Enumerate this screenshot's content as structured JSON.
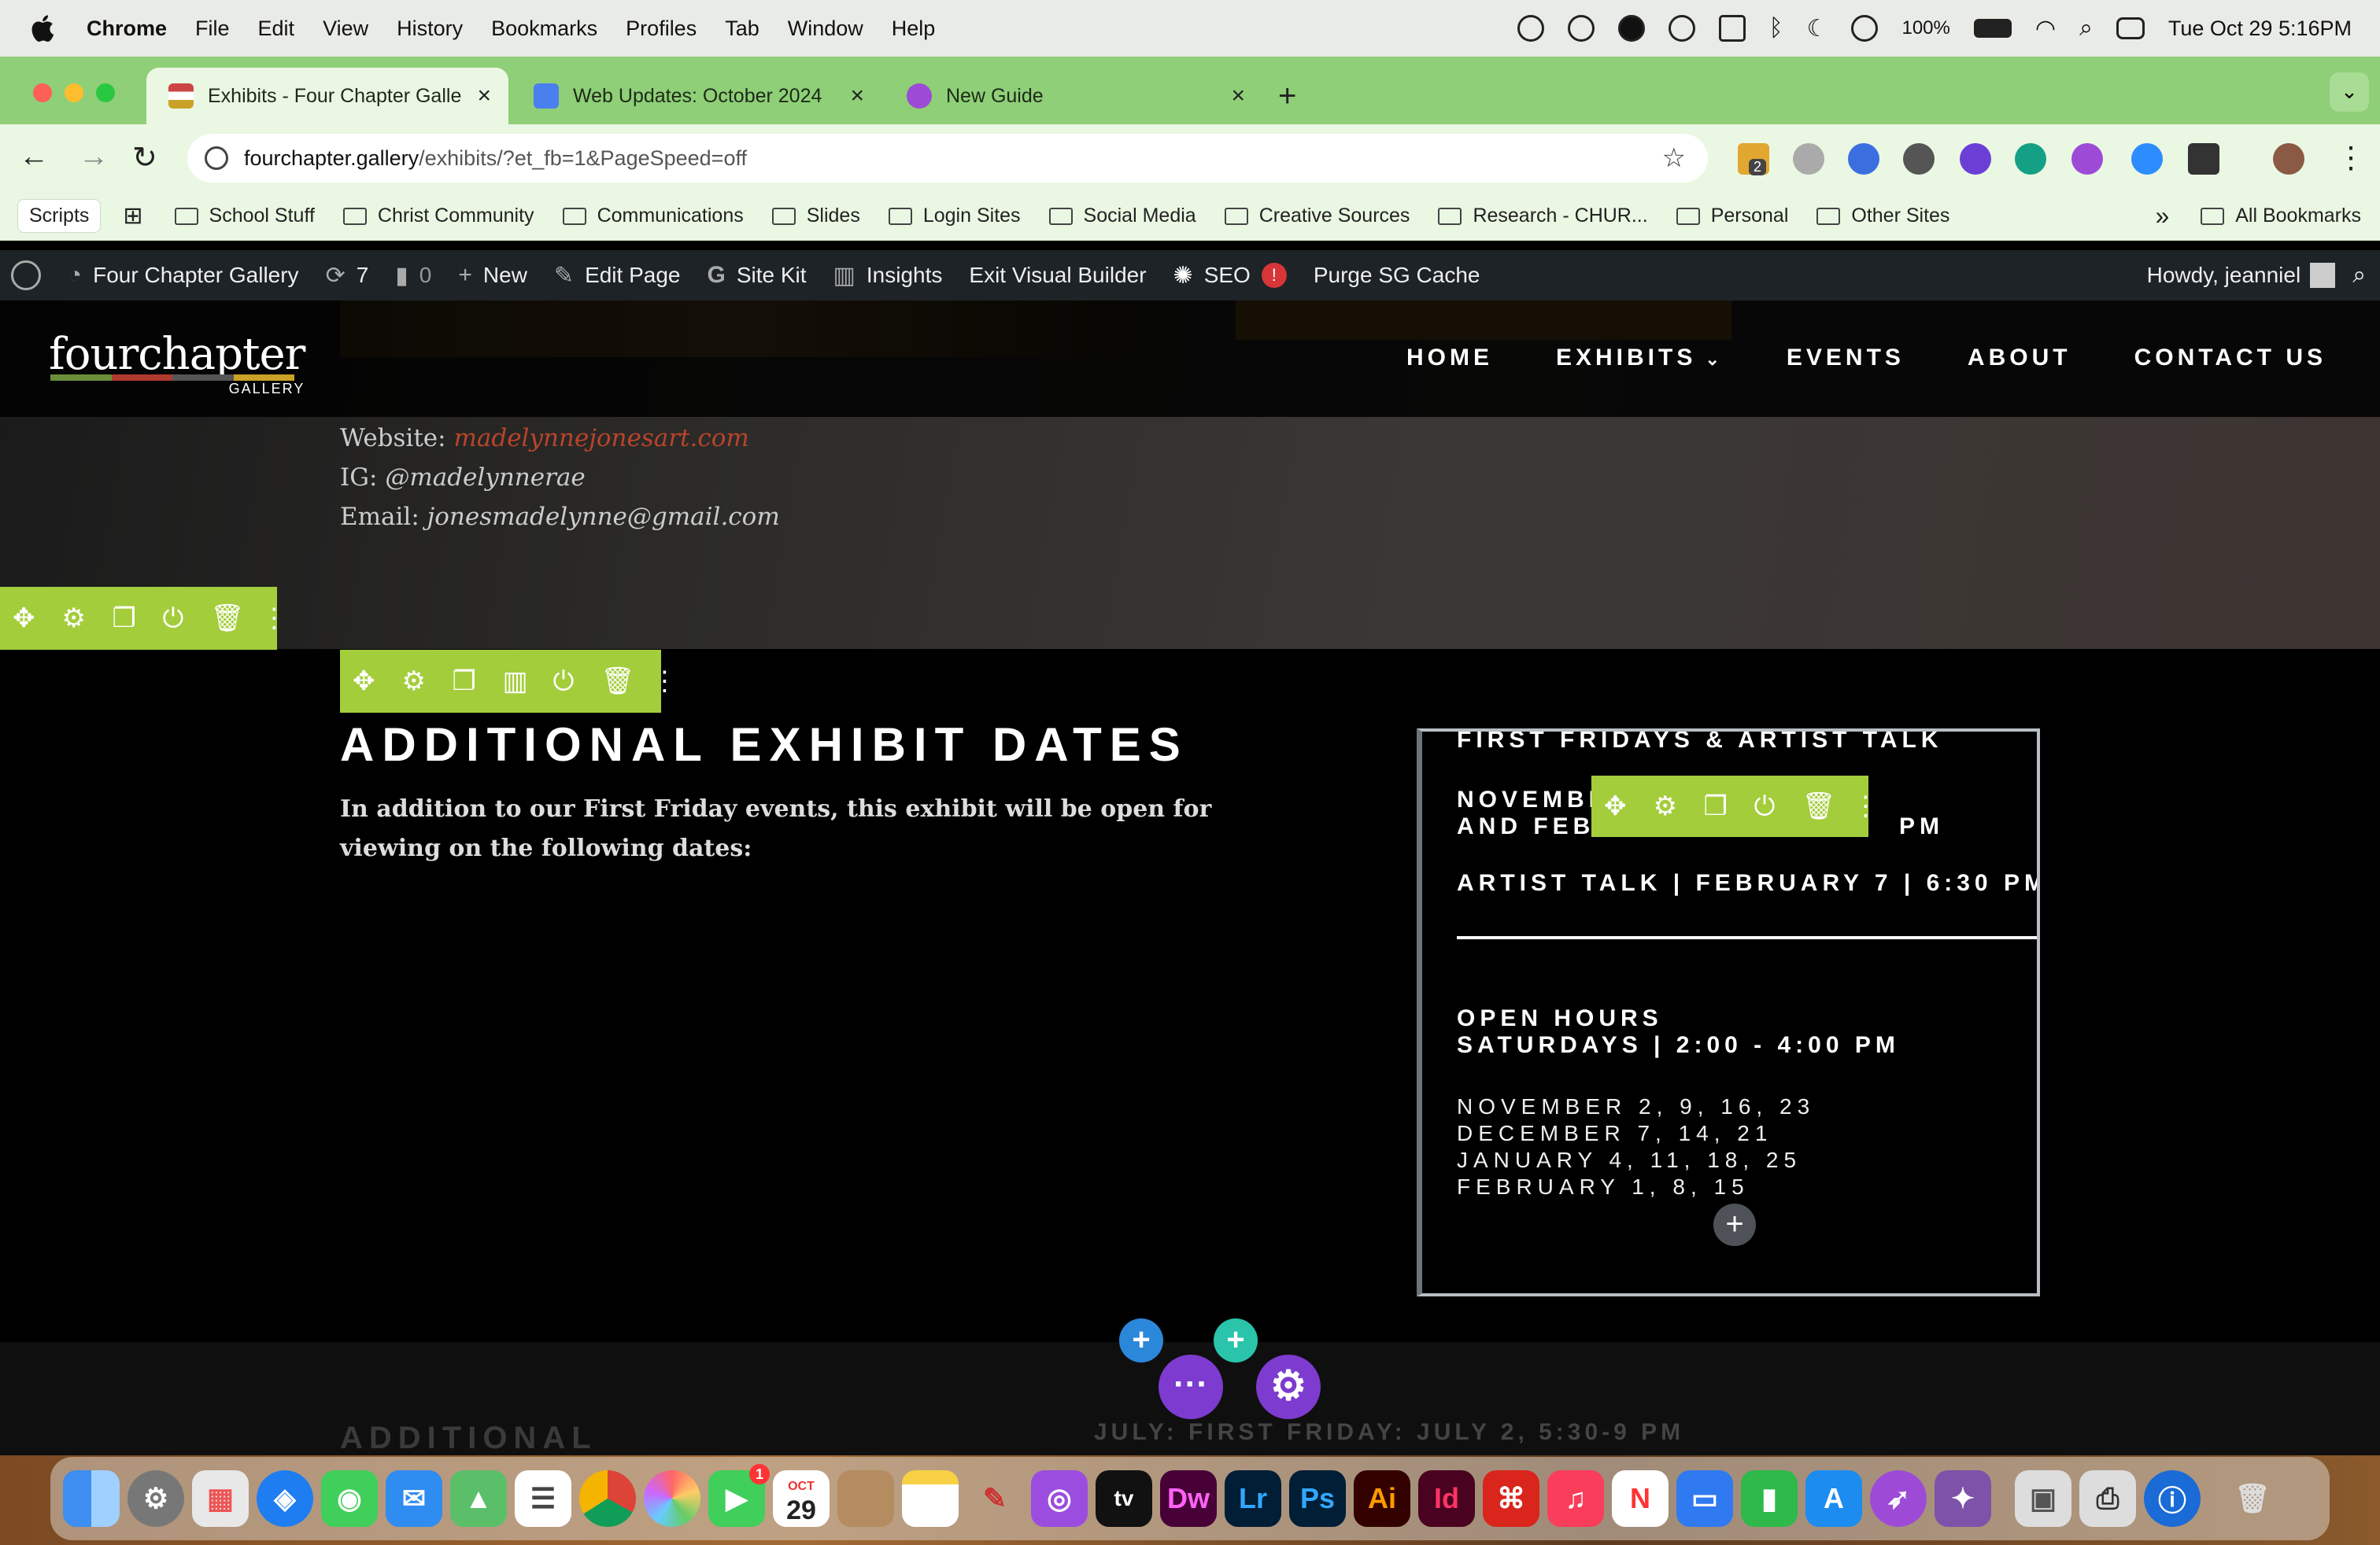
{
  "menubar": {
    "app": "Chrome",
    "items": [
      "File",
      "Edit",
      "View",
      "History",
      "Bookmarks",
      "Profiles",
      "Tab",
      "Window",
      "Help"
    ],
    "battery": "100%",
    "datetime": "Tue Oct 29  5:16PM"
  },
  "tabs": [
    {
      "title": "Exhibits - Four Chapter Galle"
    },
    {
      "title": "Web Updates: October 2024"
    },
    {
      "title": "New Guide"
    }
  ],
  "address": {
    "host": "fourchapter.gallery",
    "path": "/exhibits/?et_fb=1&PageSpeed=off"
  },
  "ext_badge": "2",
  "bookmarks": {
    "scripts": "Scripts",
    "items": [
      "School Stuff",
      "Christ Community",
      "Communications",
      "Slides",
      "Login Sites",
      "Social Media",
      "Creative Sources",
      "Research - CHUR...",
      "Personal",
      "Other Sites"
    ],
    "more": "»",
    "all": "All Bookmarks"
  },
  "wpbar": {
    "site": "Four Chapter Gallery",
    "updates": "7",
    "comments": "0",
    "new": "New",
    "edit": "Edit Page",
    "sitekit": "Site Kit",
    "insights": "Insights",
    "exit": "Exit Visual Builder",
    "seo": "SEO",
    "seo_badge": "!",
    "purge": "Purge SG Cache",
    "howdy": "Howdy, jeanniel"
  },
  "site": {
    "logo": "fourchapter",
    "logo_sub": "GALLERY",
    "nav": [
      "HOME",
      "EXHIBITS",
      "EVENTS",
      "ABOUT",
      "CONTACT US"
    ],
    "contact": {
      "website_label": "Website:",
      "website": "madelynnejonesart.com",
      "ig_label": "IG:",
      "ig": "@madelynnerae",
      "email_label": "Email:",
      "email": "jonesmadelynne@gmail.com"
    },
    "section": {
      "title": "ADDITIONAL EXHIBIT DATES",
      "text": "In addition to our First Friday events, this exhibit will be open for viewing on the following dates:"
    },
    "box": {
      "line1": "FIRST FRIDAYS & ARTIST TALK",
      "line2a": "NOVEMBE",
      "line2b": "AND FEB",
      "line2c": "PM",
      "talk": "ARTIST TALK | FEBRUARY 7  | 6:30 PM",
      "open1": "OPEN HOURS",
      "open2": "SATURDAYS | 2:00 - 4:00 PM",
      "dates": [
        "NOVEMBER 2, 9, 16, 23",
        "DECEMBER 7, 14, 21",
        "JANUARY 4, 11, 18, 25",
        "FEBRUARY 1, 8, 15"
      ]
    },
    "next": {
      "title": "ADDITIONAL",
      "right": "JULY: FIRST FRIDAY: JULY 2, 5:30-9 PM"
    }
  },
  "dock": {
    "cal_month": "OCT",
    "cal_day": "29",
    "facetime_badge": "1"
  }
}
